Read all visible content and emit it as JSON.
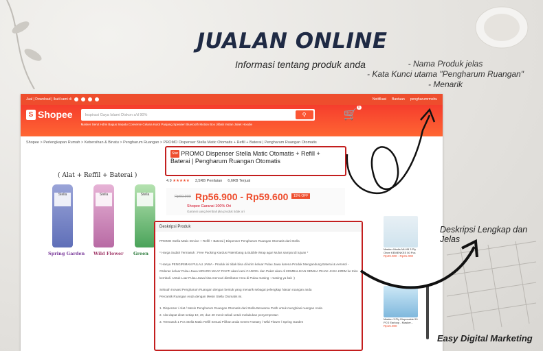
{
  "slide": {
    "title": "JUALAN ONLINE",
    "subtitle": "Informasi tentang produk anda",
    "notes": [
      "- Nama Produk jelas",
      "- Kata Kunci utama \"Pengharum Ruangan\"",
      "- Menarik"
    ],
    "side_note": "Deskripsi Lengkap dan Jelas",
    "brand": "Easy Digital Marketing",
    "annotation_color": "#c31e1e"
  },
  "shopee": {
    "topbar": {
      "left": "Jual | Download | Ikuti kami di",
      "notif": "Notifikasi",
      "help": "Bantuan",
      "user": "pengharumrmshu"
    },
    "logo": "Shopee",
    "search_placeholder": "Inspirasi Gaya Islami Diskon s/d 90%",
    "hotlinks": "Masker Serut   Hdmi Bagus   Sepatu Converse   Celana Kulot Panjang   Speaker Bluetooth   Motion Box   Jilbab Instan   Jaket Hoodie",
    "breadcrumb": "Shopee > Perlengkapan Rumah > Kebersihan & Binatu > Pengharum Ruangan > PROMO Dispenser Stella Matic Otomatis + Refill + Baterai | Pengharum Ruangan Otomatis",
    "image_caption": "( Alat + Reffil + Baterai )",
    "variants": [
      "Spring Garden",
      "Wild Flower",
      "Green"
    ],
    "product": {
      "tag": "Star",
      "title": "PROMO Dispenser Stella Matic Otomatis + Refill + Baterai | Pengharum Ruangan Otomatis",
      "rating": "4.9",
      "stars": "★★★★★",
      "reviews": "3,5RB Penilaian",
      "sold": "6,6RB Terjual",
      "old_price": "Rp69.900",
      "price": "Rp56.900 - Rp59.600",
      "discount": "15% OFF",
      "guarantee": "Shopee Garansi 100% Ori",
      "guarantee_sub": "Garansi uang kembali jika produk tidak ori"
    },
    "description": {
      "header": "Deskripsi Produk",
      "lines": [
        "PROMO Stella Matic Device + Refill + Baterai | Dispenser Pengharum Ruangan Otomatis dari Stella",
        "* Harga Sudah Termasuk : Free Packing Kardus Palembang & Bubble Wrap agar Mulus sampai di tujuan *",
        "* Hanya PENGIRIMAN PULAU JAWA - Produk ini tidak bisa di kirim keluar Pulau Jawa karena Produk Mengandung Baterai & Aerosol -",
        "Orderan keluar Pulau Jawa MOHON MAAF PASTI akan kami CANCEL dan Paket akan di KEMBALIKAN SEMUA PIHAK JASA KIRIM ke toko",
        "kembali. Untuk Luar Pulau Jawa bisa mencari distributor Area di Pulau masing - masing ya kak :)",
        "Sebuah Inovasi Pengharum Ruangan dengan bentuk yang menarik sebagai pelengkap hiasan ruangan anda",
        "Percantik Ruangan Anda dengan Mesin Stella Otomatis ini.",
        "1. Dispenser / Alat / Mesin Pengharum Ruangan Otomatis dari Stella Berwarna Putih untuk menghiasi ruangan Anda",
        "2. Alat dapat diset setiap 10, 20, dan 40 menit sekali untuk melakukan penyemprotan",
        "3. Termasuk 1 Pcs Stella Matic Refill Sesuai Pilihan anda Green Fantasy / Wild Flower / Spring Garden"
      ]
    },
    "related": [
      {
        "title": "Masker Medis MLHB 3 Ply Ohee KEMENKES 50 Pcs",
        "price": "Rp29.000 - Rp31.000"
      },
      {
        "title": "Masker 3 Ply Disposable 50 PCS Earloop - Masker...",
        "price": "Rp15.000"
      }
    ]
  }
}
